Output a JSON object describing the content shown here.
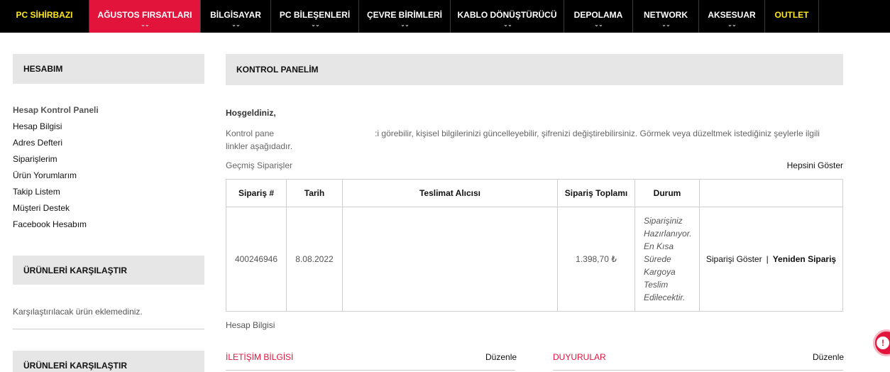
{
  "nav": {
    "items": [
      {
        "label": "PC SİHİRBAZI",
        "style": "yellow",
        "chevron": false
      },
      {
        "label": "AĞUSTOS FIRSATLARI",
        "style": "red",
        "chevron": true
      },
      {
        "label": "BİLGİSAYAR",
        "style": "",
        "chevron": true
      },
      {
        "label": "PC BİLEŞENLERİ",
        "style": "",
        "chevron": true
      },
      {
        "label": "ÇEVRE BİRİMLERİ",
        "style": "",
        "chevron": true
      },
      {
        "label": "KABLO DÖNÜŞTÜRÜCÜ",
        "style": "",
        "chevron": true
      },
      {
        "label": "DEPOLAMA",
        "style": "",
        "chevron": true
      },
      {
        "label": "NETWORK",
        "style": "",
        "chevron": true
      },
      {
        "label": "AKSESUAR",
        "style": "",
        "chevron": true
      },
      {
        "label": "OUTLET",
        "style": "yellow",
        "chevron": false
      }
    ],
    "chevron_glyph": "⌄⌄"
  },
  "colors": {
    "accent_red": "#e3143c",
    "accent_yellow": "#ffe81a",
    "nav_bg": "#000000",
    "box_bg": "#e6e6e6"
  },
  "sidebar": {
    "account_title": "HESABIM",
    "links": [
      {
        "label": "Hesap Kontrol Paneli",
        "active": true
      },
      {
        "label": "Hesap Bilgisi",
        "active": false
      },
      {
        "label": "Adres Defteri",
        "active": false
      },
      {
        "label": "Siparişlerim",
        "active": false
      },
      {
        "label": "Ürün Yorumlarım",
        "active": false
      },
      {
        "label": "Takip Listem",
        "active": false
      },
      {
        "label": "Müşteri Destek",
        "active": false
      },
      {
        "label": "Facebook Hesabım",
        "active": false
      }
    ],
    "compare_title": "ÜRÜNLERİ KARŞILAŞTIR",
    "compare_empty": "Karşılaştırılacak ürün eklemediniz.",
    "compare_title_2": "ÜRÜNLERİ KARŞILAŞTIR"
  },
  "main": {
    "title": "KONTROL PANELİM",
    "welcome": "Hoşgeldiniz,",
    "intro_start": "Kontrol pane",
    "intro_end": ":i görebilir, kişisel bilgilerinizi güncelleyebilir, şifrenizi değiştirebilirsiniz. Görmek veya düzeltmek istediğiniz şeylerle ilgili linkler aşağıdadır.",
    "past_orders_label": "Geçmiş Siparişler",
    "show_all": "Hepsini Göster",
    "orders": {
      "headers": [
        "Sipariş #",
        "Tarih",
        "Teslimat Alıcısı",
        "Sipariş Toplamı",
        "Durum",
        ""
      ],
      "rows": [
        {
          "order_no": "400246946",
          "date": "8.08.2022",
          "recipient": "",
          "total": "1.398,70 ₺",
          "status": [
            "Siparişiniz",
            "Hazırlanıyor.",
            "En Kısa",
            "Sürede",
            "Kargoya",
            "Teslim",
            "Edilecektir."
          ],
          "show_order": "Siparişi Göster",
          "separator": "|",
          "reorder": "Yeniden Sipariş"
        }
      ]
    },
    "account_info_label": "Hesap Bilgisi",
    "contact_title": "İLETİŞİM BİLGİSİ",
    "contact_edit": "Düzenle",
    "news_title": "DUYURULAR",
    "news_edit": "Düzenle"
  },
  "chat": {
    "icon": "chat-icon",
    "glyph": "!"
  }
}
